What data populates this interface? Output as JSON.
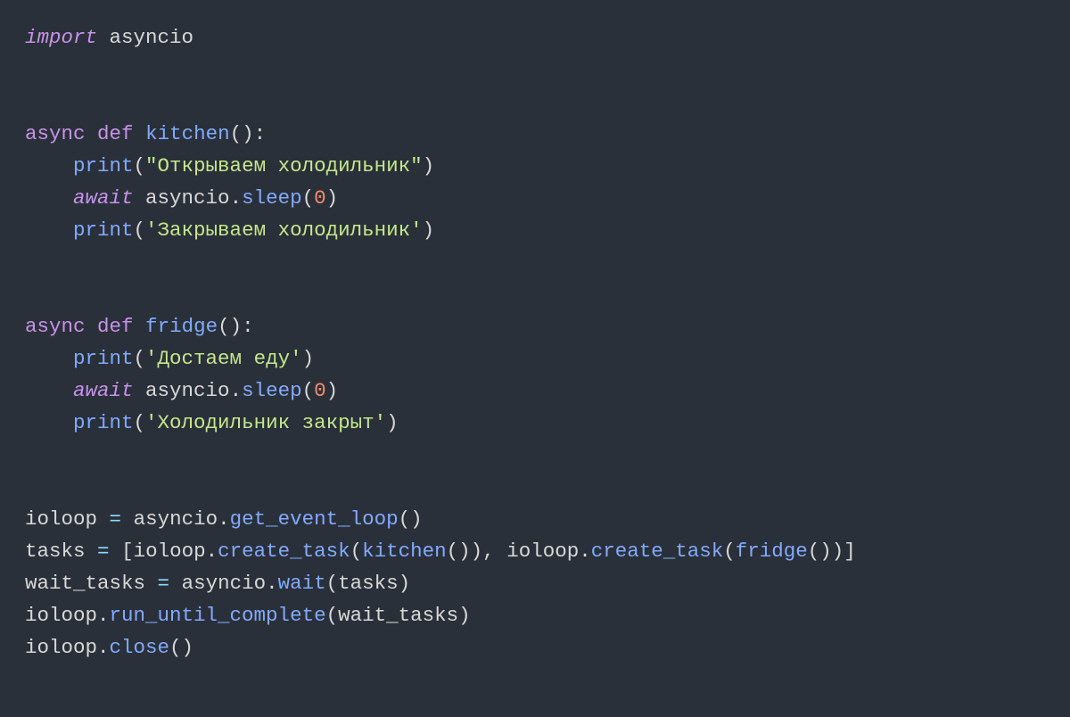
{
  "code": {
    "lines": [
      {
        "t": "import_line",
        "tokens": [
          {
            "c": "kw2",
            "v": "import"
          },
          {
            "c": "punc",
            "v": " "
          },
          {
            "c": "mod",
            "v": "asyncio"
          }
        ]
      },
      {
        "t": "blank"
      },
      {
        "t": "blank"
      },
      {
        "t": "def_line",
        "tokens": [
          {
            "c": "kw",
            "v": "async"
          },
          {
            "c": "punc",
            "v": " "
          },
          {
            "c": "kw",
            "v": "def"
          },
          {
            "c": "punc",
            "v": " "
          },
          {
            "c": "fndef",
            "v": "kitchen"
          },
          {
            "c": "punc",
            "v": "():"
          }
        ]
      },
      {
        "t": "body",
        "indent": 1,
        "tokens": [
          {
            "c": "call",
            "v": "print"
          },
          {
            "c": "punc",
            "v": "("
          },
          {
            "c": "str",
            "v": "\"Открываем холодильник\""
          },
          {
            "c": "punc",
            "v": ")"
          }
        ]
      },
      {
        "t": "body",
        "indent": 1,
        "tokens": [
          {
            "c": "await",
            "v": "await"
          },
          {
            "c": "punc",
            "v": " "
          },
          {
            "c": "mod",
            "v": "asyncio"
          },
          {
            "c": "punc",
            "v": "."
          },
          {
            "c": "call",
            "v": "sleep"
          },
          {
            "c": "punc",
            "v": "("
          },
          {
            "c": "num",
            "v": "0"
          },
          {
            "c": "punc",
            "v": ")"
          }
        ]
      },
      {
        "t": "body",
        "indent": 1,
        "tokens": [
          {
            "c": "call",
            "v": "print"
          },
          {
            "c": "punc",
            "v": "("
          },
          {
            "c": "str",
            "v": "'Закрываем холодильник'"
          },
          {
            "c": "punc",
            "v": ")"
          }
        ]
      },
      {
        "t": "blank"
      },
      {
        "t": "blank"
      },
      {
        "t": "def_line",
        "tokens": [
          {
            "c": "kw",
            "v": "async"
          },
          {
            "c": "punc",
            "v": " "
          },
          {
            "c": "kw",
            "v": "def"
          },
          {
            "c": "punc",
            "v": " "
          },
          {
            "c": "fndef",
            "v": "fridge"
          },
          {
            "c": "punc",
            "v": "():"
          }
        ]
      },
      {
        "t": "body",
        "indent": 1,
        "tokens": [
          {
            "c": "call",
            "v": "print"
          },
          {
            "c": "punc",
            "v": "("
          },
          {
            "c": "str",
            "v": "'Достаем еду'"
          },
          {
            "c": "punc",
            "v": ")"
          }
        ]
      },
      {
        "t": "body",
        "indent": 1,
        "tokens": [
          {
            "c": "await",
            "v": "await"
          },
          {
            "c": "punc",
            "v": " "
          },
          {
            "c": "mod",
            "v": "asyncio"
          },
          {
            "c": "punc",
            "v": "."
          },
          {
            "c": "call",
            "v": "sleep"
          },
          {
            "c": "punc",
            "v": "("
          },
          {
            "c": "num",
            "v": "0"
          },
          {
            "c": "punc",
            "v": ")"
          }
        ]
      },
      {
        "t": "body",
        "indent": 1,
        "tokens": [
          {
            "c": "call",
            "v": "print"
          },
          {
            "c": "punc",
            "v": "("
          },
          {
            "c": "str",
            "v": "'Холодильник закрыт'"
          },
          {
            "c": "punc",
            "v": ")"
          }
        ]
      },
      {
        "t": "blank"
      },
      {
        "t": "blank"
      },
      {
        "t": "stmt",
        "tokens": [
          {
            "c": "var",
            "v": "ioloop"
          },
          {
            "c": "punc",
            "v": " "
          },
          {
            "c": "op",
            "v": "="
          },
          {
            "c": "punc",
            "v": " "
          },
          {
            "c": "mod",
            "v": "asyncio"
          },
          {
            "c": "punc",
            "v": "."
          },
          {
            "c": "call",
            "v": "get_event_loop"
          },
          {
            "c": "punc",
            "v": "()"
          }
        ]
      },
      {
        "t": "stmt",
        "tokens": [
          {
            "c": "var",
            "v": "tasks"
          },
          {
            "c": "punc",
            "v": " "
          },
          {
            "c": "op",
            "v": "="
          },
          {
            "c": "punc",
            "v": " "
          },
          {
            "c": "punc",
            "v": "["
          },
          {
            "c": "var",
            "v": "ioloop"
          },
          {
            "c": "punc",
            "v": "."
          },
          {
            "c": "call",
            "v": "create_task"
          },
          {
            "c": "punc",
            "v": "("
          },
          {
            "c": "call",
            "v": "kitchen"
          },
          {
            "c": "punc",
            "v": "()), "
          },
          {
            "c": "var",
            "v": "ioloop"
          },
          {
            "c": "punc",
            "v": "."
          },
          {
            "c": "call",
            "v": "create_task"
          },
          {
            "c": "punc",
            "v": "("
          },
          {
            "c": "call",
            "v": "fridge"
          },
          {
            "c": "punc",
            "v": "())"
          },
          {
            "c": "punc",
            "v": "]"
          }
        ]
      },
      {
        "t": "stmt",
        "tokens": [
          {
            "c": "var",
            "v": "wait_tasks"
          },
          {
            "c": "punc",
            "v": " "
          },
          {
            "c": "op",
            "v": "="
          },
          {
            "c": "punc",
            "v": " "
          },
          {
            "c": "mod",
            "v": "asyncio"
          },
          {
            "c": "punc",
            "v": "."
          },
          {
            "c": "call",
            "v": "wait"
          },
          {
            "c": "punc",
            "v": "("
          },
          {
            "c": "var",
            "v": "tasks"
          },
          {
            "c": "punc",
            "v": ")"
          }
        ]
      },
      {
        "t": "stmt",
        "tokens": [
          {
            "c": "var",
            "v": "ioloop"
          },
          {
            "c": "punc",
            "v": "."
          },
          {
            "c": "call",
            "v": "run_until_complete"
          },
          {
            "c": "punc",
            "v": "("
          },
          {
            "c": "var",
            "v": "wait_tasks"
          },
          {
            "c": "punc",
            "v": ")"
          }
        ]
      },
      {
        "t": "stmt",
        "tokens": [
          {
            "c": "var",
            "v": "ioloop"
          },
          {
            "c": "punc",
            "v": "."
          },
          {
            "c": "call",
            "v": "close"
          },
          {
            "c": "punc",
            "v": "()"
          }
        ]
      }
    ],
    "indent_unit": "    "
  }
}
